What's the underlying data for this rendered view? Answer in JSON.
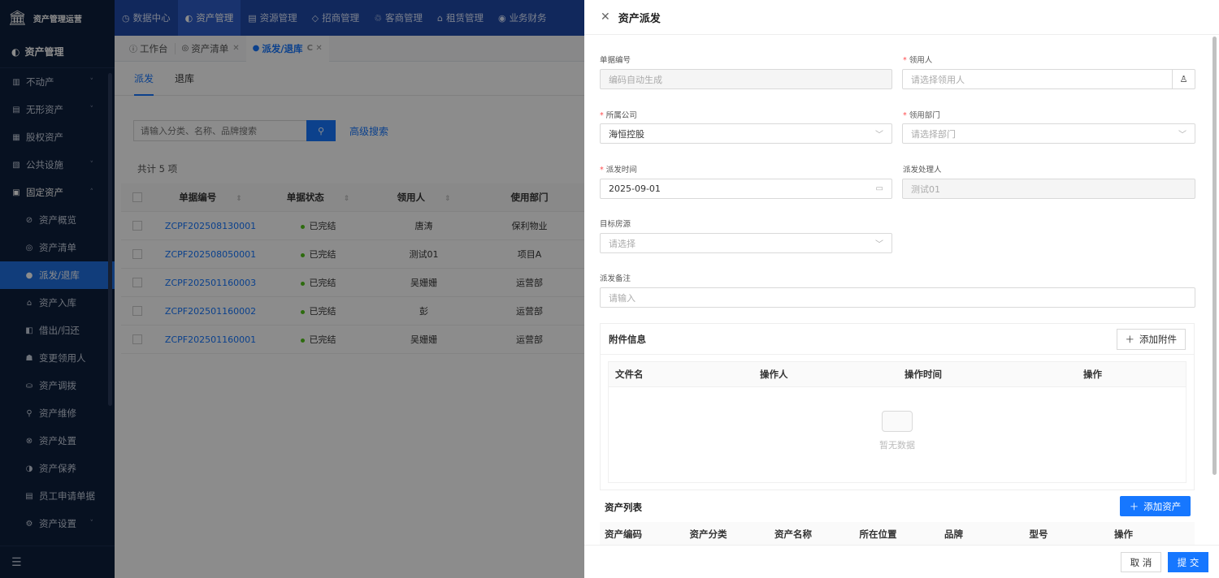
{
  "app": {
    "brand": "资产管理运营"
  },
  "topnav": [
    {
      "icon": "◷",
      "label": "数据中心"
    },
    {
      "icon": "◐",
      "label": "资产管理"
    },
    {
      "icon": "▤",
      "label": "资源管理"
    },
    {
      "icon": "◇",
      "label": "招商管理"
    },
    {
      "icon": "♲",
      "label": "客商管理"
    },
    {
      "icon": "⌂",
      "label": "租赁管理"
    },
    {
      "icon": "◉",
      "label": "业务财务"
    }
  ],
  "sidebar": {
    "header": "资产管理",
    "items": [
      {
        "icon": "▥",
        "label": "不动产",
        "chev": "˅"
      },
      {
        "icon": "▤",
        "label": "无形资产",
        "chev": "˅"
      },
      {
        "icon": "▦",
        "label": "股权资产",
        "chev": ""
      },
      {
        "icon": "▧",
        "label": "公共设施",
        "chev": "˅"
      },
      {
        "icon": "▣",
        "label": "固定资产",
        "chev": "˄"
      }
    ],
    "subitems": [
      {
        "icon": "⊘",
        "label": "资产概览"
      },
      {
        "icon": "◎",
        "label": "资产清单"
      },
      {
        "icon": "●",
        "label": "派发/退库"
      },
      {
        "icon": "⌂",
        "label": "资产入库"
      },
      {
        "icon": "◧",
        "label": "借出/归还"
      },
      {
        "icon": "☗",
        "label": "变更领用人"
      },
      {
        "icon": "⛀",
        "label": "资产调拨"
      },
      {
        "icon": "⚲",
        "label": "资产维修"
      },
      {
        "icon": "⊗",
        "label": "资产处置"
      },
      {
        "icon": "◑",
        "label": "资产保养"
      },
      {
        "icon": "▤",
        "label": "员工申请单据"
      },
      {
        "icon": "⚙",
        "label": "资产设置",
        "chev": "˅"
      }
    ],
    "bottom_icon": "☰"
  },
  "tabs": [
    {
      "icon": "ⓘ",
      "label": "工作台",
      "close": ""
    },
    {
      "icon": "◎",
      "label": "资产清单",
      "close": "✕"
    },
    {
      "icon": "●",
      "label": "派发/退库",
      "close": "C ✕"
    }
  ],
  "main": {
    "subtabs": [
      "派发",
      "退库"
    ],
    "search_placeholder": "请输入分类、名称、品牌搜索",
    "search_icon": "⚲",
    "advanced": "高级搜索",
    "count": "共计 5 项",
    "columns": [
      "单据编号",
      "单据状态",
      "领用人",
      "使用部门"
    ],
    "rows": [
      {
        "code": "ZCPF202508130001",
        "status": "已完结",
        "user": "唐涛",
        "dept": "保利物业"
      },
      {
        "code": "ZCPF202508050001",
        "status": "已完结",
        "user": "测试01",
        "dept": "项目A"
      },
      {
        "code": "ZCPF202501160003",
        "status": "已完结",
        "user": "吴姗姗",
        "dept": "运营部"
      },
      {
        "code": "ZCPF202501160002",
        "status": "已完结",
        "user": "彭",
        "dept": "运营部"
      },
      {
        "code": "ZCPF202501160001",
        "status": "已完结",
        "user": "吴姗姗",
        "dept": "运营部"
      }
    ]
  },
  "drawer": {
    "title": "资产派发",
    "close_icon": "✕",
    "fields": {
      "code_label": "单据编号",
      "code_value": "编码自动生成",
      "user_label": "领用人",
      "user_placeholder": "请选择领用人",
      "company_label": "所属公司",
      "company_value": "海恒控股",
      "dept_label": "领用部门",
      "dept_placeholder": "请选择部门",
      "time_label": "派发时间",
      "time_value": "2025-09-01",
      "handler_label": "派发处理人",
      "handler_value": "测试01",
      "room_label": "目标房源",
      "room_placeholder": "请选择",
      "remark_label": "派发备注",
      "remark_placeholder": "请输入"
    },
    "attachments": {
      "title": "附件信息",
      "add_label": "添加附件",
      "columns": [
        "文件名",
        "操作人",
        "操作时间",
        "操作"
      ],
      "empty": "暂无数据"
    },
    "assets": {
      "title": "资产列表",
      "add_label": "添加资产",
      "columns": [
        "资产编码",
        "资产分类",
        "资产名称",
        "所在位置",
        "品牌",
        "型号",
        "操作"
      ]
    },
    "footer": {
      "cancel": "取 消",
      "submit": "提 交"
    }
  }
}
